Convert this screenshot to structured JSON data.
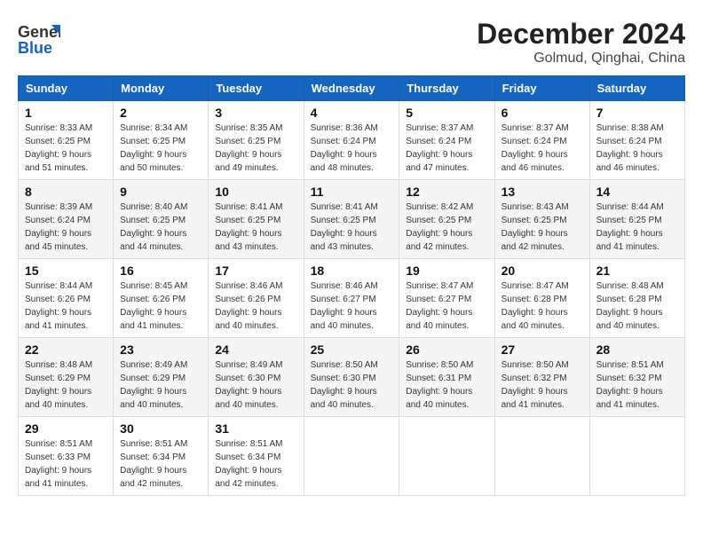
{
  "header": {
    "logo_line1": "General",
    "logo_line2": "Blue",
    "month_title": "December 2024",
    "location": "Golmud, Qinghai, China"
  },
  "weekdays": [
    "Sunday",
    "Monday",
    "Tuesday",
    "Wednesday",
    "Thursday",
    "Friday",
    "Saturday"
  ],
  "weeks": [
    [
      {
        "day": "1",
        "sunrise": "8:33 AM",
        "sunset": "6:25 PM",
        "daylight": "9 hours and 51 minutes."
      },
      {
        "day": "2",
        "sunrise": "8:34 AM",
        "sunset": "6:25 PM",
        "daylight": "9 hours and 50 minutes."
      },
      {
        "day": "3",
        "sunrise": "8:35 AM",
        "sunset": "6:25 PM",
        "daylight": "9 hours and 49 minutes."
      },
      {
        "day": "4",
        "sunrise": "8:36 AM",
        "sunset": "6:24 PM",
        "daylight": "9 hours and 48 minutes."
      },
      {
        "day": "5",
        "sunrise": "8:37 AM",
        "sunset": "6:24 PM",
        "daylight": "9 hours and 47 minutes."
      },
      {
        "day": "6",
        "sunrise": "8:37 AM",
        "sunset": "6:24 PM",
        "daylight": "9 hours and 46 minutes."
      },
      {
        "day": "7",
        "sunrise": "8:38 AM",
        "sunset": "6:24 PM",
        "daylight": "9 hours and 46 minutes."
      }
    ],
    [
      {
        "day": "8",
        "sunrise": "8:39 AM",
        "sunset": "6:24 PM",
        "daylight": "9 hours and 45 minutes."
      },
      {
        "day": "9",
        "sunrise": "8:40 AM",
        "sunset": "6:25 PM",
        "daylight": "9 hours and 44 minutes."
      },
      {
        "day": "10",
        "sunrise": "8:41 AM",
        "sunset": "6:25 PM",
        "daylight": "9 hours and 43 minutes."
      },
      {
        "day": "11",
        "sunrise": "8:41 AM",
        "sunset": "6:25 PM",
        "daylight": "9 hours and 43 minutes."
      },
      {
        "day": "12",
        "sunrise": "8:42 AM",
        "sunset": "6:25 PM",
        "daylight": "9 hours and 42 minutes."
      },
      {
        "day": "13",
        "sunrise": "8:43 AM",
        "sunset": "6:25 PM",
        "daylight": "9 hours and 42 minutes."
      },
      {
        "day": "14",
        "sunrise": "8:44 AM",
        "sunset": "6:25 PM",
        "daylight": "9 hours and 41 minutes."
      }
    ],
    [
      {
        "day": "15",
        "sunrise": "8:44 AM",
        "sunset": "6:26 PM",
        "daylight": "9 hours and 41 minutes."
      },
      {
        "day": "16",
        "sunrise": "8:45 AM",
        "sunset": "6:26 PM",
        "daylight": "9 hours and 41 minutes."
      },
      {
        "day": "17",
        "sunrise": "8:46 AM",
        "sunset": "6:26 PM",
        "daylight": "9 hours and 40 minutes."
      },
      {
        "day": "18",
        "sunrise": "8:46 AM",
        "sunset": "6:27 PM",
        "daylight": "9 hours and 40 minutes."
      },
      {
        "day": "19",
        "sunrise": "8:47 AM",
        "sunset": "6:27 PM",
        "daylight": "9 hours and 40 minutes."
      },
      {
        "day": "20",
        "sunrise": "8:47 AM",
        "sunset": "6:28 PM",
        "daylight": "9 hours and 40 minutes."
      },
      {
        "day": "21",
        "sunrise": "8:48 AM",
        "sunset": "6:28 PM",
        "daylight": "9 hours and 40 minutes."
      }
    ],
    [
      {
        "day": "22",
        "sunrise": "8:48 AM",
        "sunset": "6:29 PM",
        "daylight": "9 hours and 40 minutes."
      },
      {
        "day": "23",
        "sunrise": "8:49 AM",
        "sunset": "6:29 PM",
        "daylight": "9 hours and 40 minutes."
      },
      {
        "day": "24",
        "sunrise": "8:49 AM",
        "sunset": "6:30 PM",
        "daylight": "9 hours and 40 minutes."
      },
      {
        "day": "25",
        "sunrise": "8:50 AM",
        "sunset": "6:30 PM",
        "daylight": "9 hours and 40 minutes."
      },
      {
        "day": "26",
        "sunrise": "8:50 AM",
        "sunset": "6:31 PM",
        "daylight": "9 hours and 40 minutes."
      },
      {
        "day": "27",
        "sunrise": "8:50 AM",
        "sunset": "6:32 PM",
        "daylight": "9 hours and 41 minutes."
      },
      {
        "day": "28",
        "sunrise": "8:51 AM",
        "sunset": "6:32 PM",
        "daylight": "9 hours and 41 minutes."
      }
    ],
    [
      {
        "day": "29",
        "sunrise": "8:51 AM",
        "sunset": "6:33 PM",
        "daylight": "9 hours and 41 minutes."
      },
      {
        "day": "30",
        "sunrise": "8:51 AM",
        "sunset": "6:34 PM",
        "daylight": "9 hours and 42 minutes."
      },
      {
        "day": "31",
        "sunrise": "8:51 AM",
        "sunset": "6:34 PM",
        "daylight": "9 hours and 42 minutes."
      },
      null,
      null,
      null,
      null
    ]
  ]
}
